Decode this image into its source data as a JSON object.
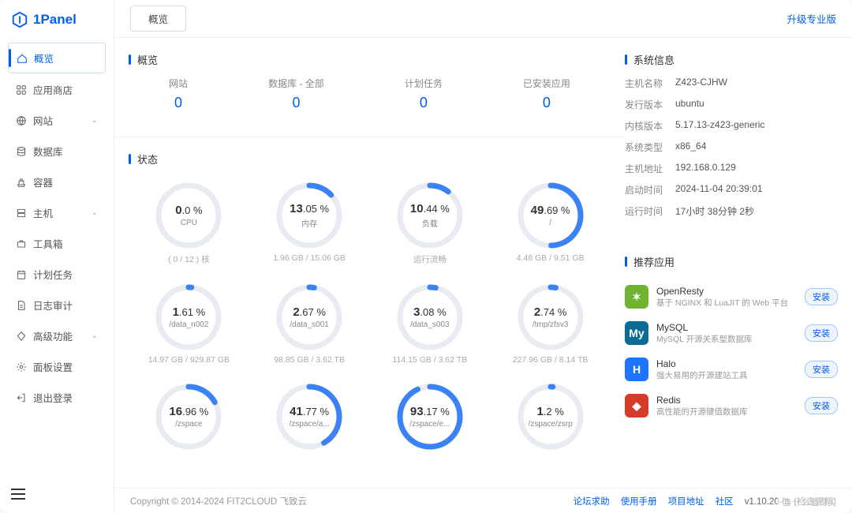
{
  "brand": "1Panel",
  "topbar": {
    "tab": "概览",
    "upgrade": "升级专业版"
  },
  "sidebar": [
    {
      "key": "overview",
      "label": "概览",
      "icon": "home",
      "active": true
    },
    {
      "key": "appstore",
      "label": "应用商店",
      "icon": "apps"
    },
    {
      "key": "website",
      "label": "网站",
      "icon": "globe",
      "expandable": true
    },
    {
      "key": "database",
      "label": "数据库",
      "icon": "stack"
    },
    {
      "key": "container",
      "label": "容器",
      "icon": "ship"
    },
    {
      "key": "host",
      "label": "主机",
      "icon": "server",
      "expandable": true
    },
    {
      "key": "toolbox",
      "label": "工具箱",
      "icon": "briefcase"
    },
    {
      "key": "cron",
      "label": "计划任务",
      "icon": "calendar"
    },
    {
      "key": "audit",
      "label": "日志审计",
      "icon": "doc"
    },
    {
      "key": "advanced",
      "label": "高级功能",
      "icon": "diamond",
      "expandable": true
    },
    {
      "key": "settings",
      "label": "面板设置",
      "icon": "gear"
    },
    {
      "key": "logout",
      "label": "退出登录",
      "icon": "exit"
    }
  ],
  "overview": {
    "title": "概览",
    "stats": [
      {
        "label": "网站",
        "value": "0"
      },
      {
        "label": "数据库 - 全部",
        "value": "0"
      },
      {
        "label": "计划任务",
        "value": "0"
      },
      {
        "label": "已安装应用",
        "value": "0"
      }
    ]
  },
  "status": {
    "title": "状态",
    "gauges": [
      {
        "pct": 0.0,
        "pct_int": "0",
        "pct_dec": ".0",
        "label": "CPU",
        "meta": "( 0 / 12 ) 核"
      },
      {
        "pct": 13.05,
        "pct_int": "13",
        "pct_dec": ".05",
        "label": "内存",
        "meta": "1.96 GB / 15.06 GB"
      },
      {
        "pct": 10.44,
        "pct_int": "10",
        "pct_dec": ".44",
        "label": "负载",
        "meta": "运行流畅"
      },
      {
        "pct": 49.69,
        "pct_int": "49",
        "pct_dec": ".69",
        "label": "/",
        "meta": "4.48 GB / 9.51 GB"
      },
      {
        "pct": 1.61,
        "pct_int": "1",
        "pct_dec": ".61",
        "label": "/data_n002",
        "meta": "14.97 GB / 929.87 GB"
      },
      {
        "pct": 2.67,
        "pct_int": "2",
        "pct_dec": ".67",
        "label": "/data_s001",
        "meta": "98.85 GB / 3.62 TB"
      },
      {
        "pct": 3.08,
        "pct_int": "3",
        "pct_dec": ".08",
        "label": "/data_s003",
        "meta": "114.15 GB / 3.62 TB"
      },
      {
        "pct": 2.74,
        "pct_int": "2",
        "pct_dec": ".74",
        "label": "/tmp/zfsv3",
        "meta": "227.96 GB / 8.14 TB"
      },
      {
        "pct": 16.96,
        "pct_int": "16",
        "pct_dec": ".96",
        "label": "/zspace",
        "meta": ""
      },
      {
        "pct": 41.77,
        "pct_int": "41",
        "pct_dec": ".77",
        "label": "/zspace/a...",
        "meta": ""
      },
      {
        "pct": 93.17,
        "pct_int": "93",
        "pct_dec": ".17",
        "label": "/zspace/e...",
        "meta": ""
      },
      {
        "pct": 1.2,
        "pct_int": "1",
        "pct_dec": ".2",
        "label": "/zspace/zsrp",
        "meta": ""
      }
    ]
  },
  "sysinfo": {
    "title": "系统信息",
    "rows": [
      {
        "k": "主机名称",
        "v": "Z423-CJHW"
      },
      {
        "k": "发行版本",
        "v": "ubuntu"
      },
      {
        "k": "内核版本",
        "v": "5.17.13-z423-generic"
      },
      {
        "k": "系统类型",
        "v": "x86_64"
      },
      {
        "k": "主机地址",
        "v": "192.168.0.129"
      },
      {
        "k": "启动时间",
        "v": "2024-11-04 20:39:01"
      },
      {
        "k": "运行时间",
        "v": "17小时 38分钟 2秒"
      }
    ]
  },
  "recommend": {
    "title": "推荐应用",
    "install_label": "安装",
    "apps": [
      {
        "name": "OpenResty",
        "desc": "基于 NGINX 和 LuaJIT 的 Web 平台",
        "color": "#6fb331",
        "glyph": "✶"
      },
      {
        "name": "MySQL",
        "desc": "MySQL 开源关系型数据库",
        "color": "#0b6b94",
        "glyph": "My"
      },
      {
        "name": "Halo",
        "desc": "强大易用的开源建站工具",
        "color": "#1f74ff",
        "glyph": "H"
      },
      {
        "name": "Redis",
        "desc": "高性能的开源键值数据库",
        "color": "#d83a2a",
        "glyph": "◆"
      }
    ]
  },
  "footer": {
    "copyright": "Copyright © 2014-2024 FIT2CLOUD 飞致云",
    "links": [
      "论坛求助",
      "使用手册",
      "项目地址",
      "社区"
    ],
    "version": "v1.10.20-lts (检查更新)"
  },
  "watermark": "值 什么值得买"
}
